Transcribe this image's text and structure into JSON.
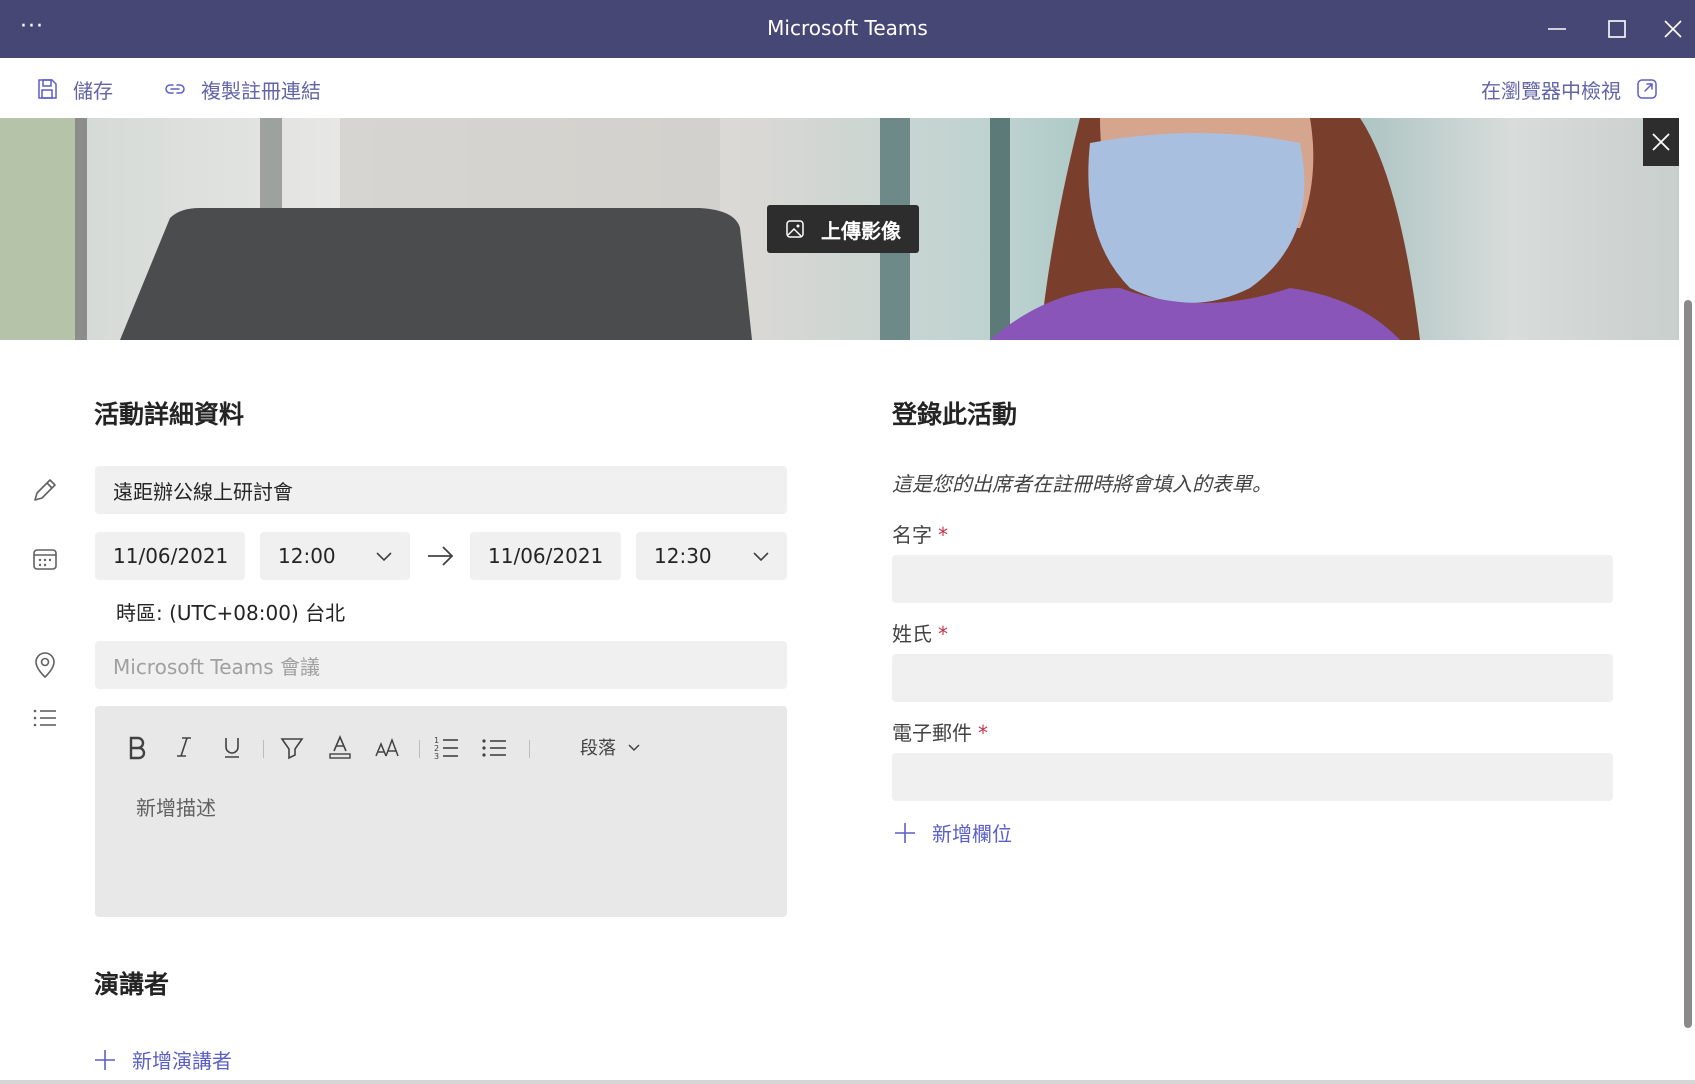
{
  "window": {
    "title": "Microsoft Teams",
    "more_label": "···",
    "minimize_icon": "minimize-icon",
    "maximize_icon": "maximize-icon",
    "close_icon": "close-icon"
  },
  "toolbar": {
    "save_label": "儲存",
    "copy_link_label": "複製註冊連結",
    "view_in_browser_label": "在瀏覽器中檢視"
  },
  "banner": {
    "upload_label": "上傳影像"
  },
  "details": {
    "heading": "活動詳細資料",
    "title_value": "遠距辦公線上研討會",
    "start_date": "11/06/2021",
    "start_time": "12:00",
    "end_date": "11/06/2021",
    "end_time": "12:30",
    "timezone": "時區: (UTC+08:00) 台北",
    "location_placeholder": "Microsoft Teams 會議",
    "description_placeholder": "新增描述",
    "paragraph_label": "段落"
  },
  "speakers": {
    "heading": "演講者",
    "add_label": "新增演講者"
  },
  "registration": {
    "heading": "登錄此活動",
    "description": "這是您的出席者在註冊時將會填入的表單。",
    "fields": [
      {
        "label": "名字",
        "required": "*",
        "value": ""
      },
      {
        "label": "姓氏",
        "required": "*",
        "value": ""
      },
      {
        "label": "電子郵件",
        "required": "*",
        "value": ""
      }
    ],
    "add_field_label": "新增欄位"
  },
  "colors": {
    "titlebar": "#464775",
    "accent": "#5b5fc7",
    "required": "#c4314b"
  }
}
